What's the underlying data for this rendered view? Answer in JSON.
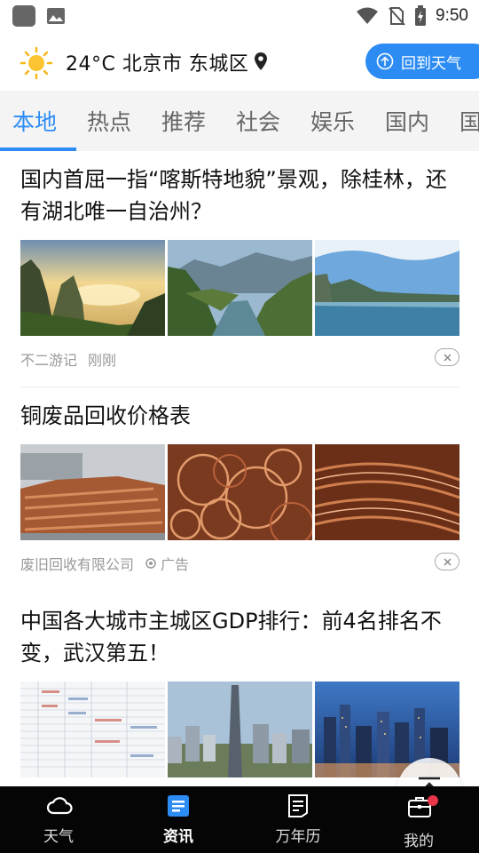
{
  "status_bar": {
    "time": "9:50",
    "icons": [
      "app-icon",
      "image-icon",
      "wifi-icon",
      "no-sim-icon",
      "battery-charging-icon"
    ]
  },
  "header": {
    "weather_icon": "sun-icon",
    "weather_text": "24°C 北京市 东城区",
    "location_icon": "location-pin-icon",
    "back_button_label": "回到天气"
  },
  "tabs": [
    {
      "label": "本地",
      "active": true
    },
    {
      "label": "热点",
      "active": false
    },
    {
      "label": "推荐",
      "active": false
    },
    {
      "label": "社会",
      "active": false
    },
    {
      "label": "娱乐",
      "active": false
    },
    {
      "label": "国内",
      "active": false
    },
    {
      "label": "国",
      "active": false
    }
  ],
  "articles": [
    {
      "title": "国内首屈一指“喀斯特地貌”景观，除桂林，还有湖北唯一自治州？",
      "source": "不二游记",
      "time": "刚刚",
      "images": [
        "karst-cliffs-sunset",
        "river-gorge-valley",
        "lake-cliff-landscape"
      ]
    },
    {
      "title": "铜废品回收价格表",
      "source": "废旧回收有限公司",
      "ad_label": "广告",
      "images": [
        "copper-pipes-pile",
        "copper-wire-coils",
        "copper-wire-bundle"
      ]
    },
    {
      "title": "中国各大城市主城区GDP排行：前4名排名不变，武汉第五！",
      "images": [
        "gdp-ranking-table",
        "city-skyscraper-aerial",
        "city-night-skyline"
      ]
    }
  ],
  "scroll_top_icon": "arrow-up-icon",
  "bottom_nav": [
    {
      "label": "天气",
      "icon": "cloud-icon",
      "active": false
    },
    {
      "label": "资讯",
      "icon": "news-icon",
      "active": true
    },
    {
      "label": "万年历",
      "icon": "calendar-icon",
      "active": false
    },
    {
      "label": "我的",
      "icon": "briefcase-icon",
      "active": false,
      "badge": true
    }
  ],
  "colors": {
    "accent": "#2c8cf4",
    "badge": "#e8354a",
    "nav_bg": "#050505",
    "tab_bg": "#f4f4f4"
  }
}
